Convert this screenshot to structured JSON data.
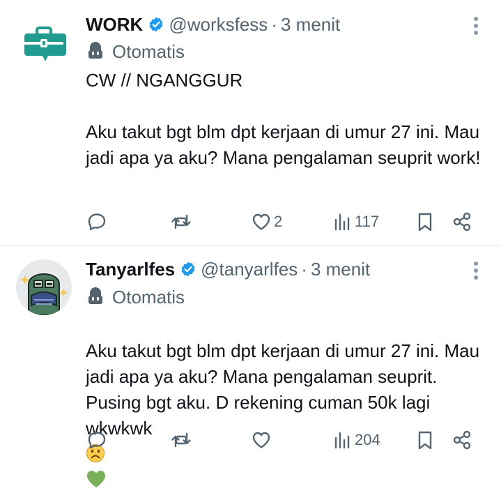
{
  "tweets": [
    {
      "name": "WORK",
      "handle": "@worksfess",
      "separator": "·",
      "time": "3 menit",
      "label": "Otomatis",
      "text": "CW // NGANGGUR\n\nAku takut bgt blm dpt kerjaan di umur 27 ini. Mau jadi apa ya aku? Mana pengalaman seuprit work!",
      "likes": "2",
      "views": "117"
    },
    {
      "name": "Tanyarlfes",
      "handle": "@tanyarlfes",
      "separator": "·",
      "time": "3 menit",
      "label": "Otomatis",
      "text": "Aku takut bgt blm dpt kerjaan di umur 27 ini. Mau jadi apa ya aku? Mana pengalaman seuprit. Pusing bgt aku. D rekening cuman 50k lagi wkwkwk",
      "emojis": [
        "frowning-face",
        "green-heart"
      ],
      "likes": "",
      "views": "204"
    }
  ],
  "colors": {
    "text": "#0f1419",
    "secondary": "#536471",
    "verified": "#1d9bf0",
    "work_avatar": "#1f9c8f"
  }
}
